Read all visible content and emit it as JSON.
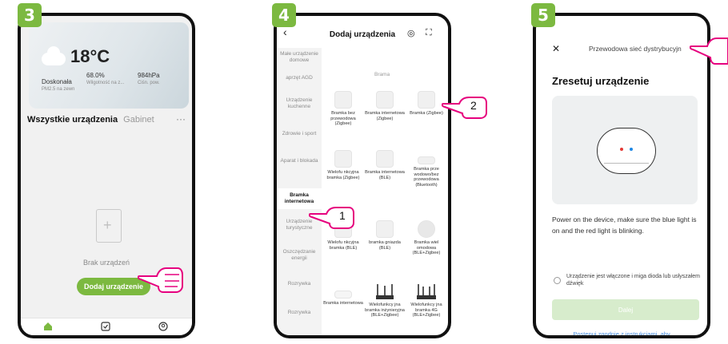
{
  "steps": [
    "3",
    "4",
    "5"
  ],
  "phone3": {
    "temperature": "18°C",
    "air_quality": "Doskonała",
    "air_quality_sub": "PM2.5 na zewn",
    "humidity": "68.0%",
    "humidity_sub": "Wilgotność na z...",
    "pressure": "984hPa",
    "pressure_sub": "Ciśn. pow.",
    "tab_all": "Wszystkie urządzenia",
    "tab_room": "Gabinet",
    "more": "···",
    "empty_text": "Brak urządzeń",
    "add_button": "Dodaj urządzenie"
  },
  "phone4": {
    "title": "Dodaj urządzenia",
    "categories": [
      "Małe urządzenie domowe",
      "aprzęt AGD",
      "Urządzenie kuchenne",
      "Zdrowie i sport",
      "Aparat i blokada",
      "Bramka internetowa",
      "Urządzenie turystyczne",
      "Oszczędzanie energii",
      "Rozrywka",
      "Rozrywka"
    ],
    "section_label": "Brama",
    "devices": [
      "Bramka bez przewodowa (Zigbee)",
      "Bramka internetowa (Zigbee)",
      "Bramka (Zigbee)",
      "Wielofu nkcyjna bramka (Zigbee)",
      "Bramka internetowa (BLE)",
      "Bramka prze wodowo/bez przewodowa (Bluetooth)",
      "Wielofu nkcyjna bramka (BLE)",
      "bramka gniazda (BLE)",
      "Bramka wiel omodowa (BLE+Zigbee)",
      "Bramka internetowa",
      "Wielofunkcy jna bramka inżynieryjna (BLE+Zigbee)",
      "Wielofunkcy jna bramka 4G (BLE+Zigbee)"
    ],
    "callout_1": "1",
    "callout_2": "2"
  },
  "phone5": {
    "title": "Przewodowa sieć dystrybucyjn",
    "heading": "Zresetuj urządzenie",
    "description": "Power on the device, make sure the blue light is on and the red light is blinking.",
    "checkbox_label": "Urządzenie jest włączone i miga dioda lub usłyszałem dźwięk",
    "next_button": "Dalej",
    "link_text": "Postępuj zgodnie z instrukcjami, aby",
    "led_colors": [
      "#e53935",
      "#1e88e5"
    ]
  },
  "colors": {
    "accent": "#7cb940",
    "link": "#4a90e2"
  },
  "icons": [
    "home-icon",
    "scene-icon",
    "profile-icon",
    "back-icon",
    "target-icon",
    "scan-icon",
    "close-icon",
    "document-plus-icon",
    "cloud-icon",
    "pointing-hand-icon"
  ]
}
